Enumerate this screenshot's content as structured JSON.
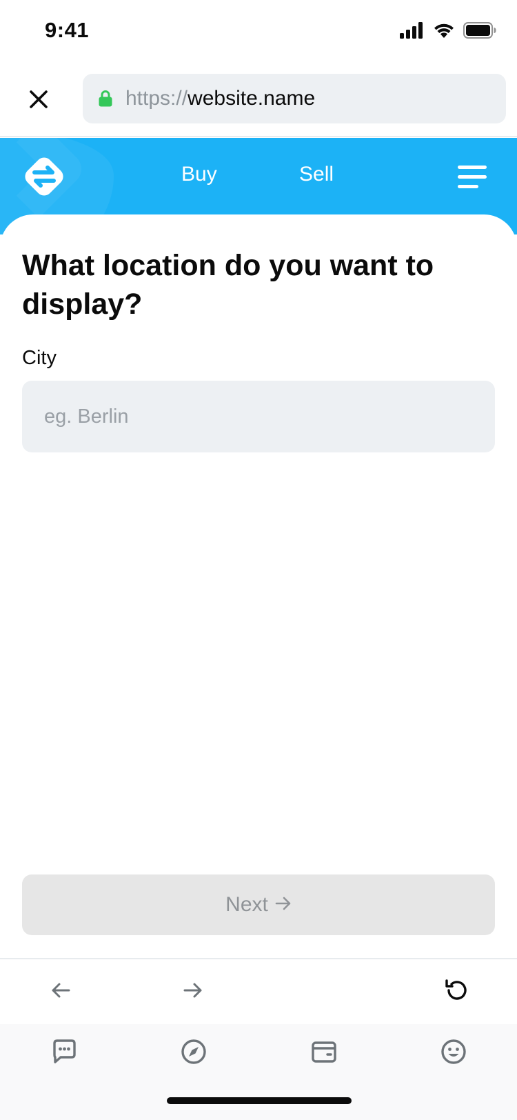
{
  "status_bar": {
    "time": "9:41",
    "icons": [
      "cellular-signal-icon",
      "wifi-icon",
      "battery-icon"
    ]
  },
  "browser": {
    "close_icon": "close-icon",
    "url_scheme": "https://",
    "url_host": "website.name",
    "lock_icon": "lock-icon",
    "lock_color": "#34c759"
  },
  "site_header": {
    "background_color": "#1cb2f6",
    "logo_icon": "exchange-arrows-logo-icon",
    "nav": [
      {
        "label": "Buy"
      },
      {
        "label": "Sell"
      }
    ],
    "menu_icon": "hamburger-menu-icon"
  },
  "form": {
    "title": "What location do you want to display?",
    "city_label": "City",
    "city_value": "",
    "city_placeholder": "eg. Berlin",
    "next_label": "Next",
    "next_icon": "arrow-right-icon",
    "next_enabled": false
  },
  "browser_nav": {
    "back_icon": "arrow-left-icon",
    "forward_icon": "arrow-right-icon",
    "reload_icon": "reload-icon"
  },
  "tab_bar": {
    "tabs": [
      {
        "icon": "chat-bubble-icon"
      },
      {
        "icon": "compass-icon"
      },
      {
        "icon": "wallet-icon"
      },
      {
        "icon": "smiley-face-icon"
      }
    ]
  }
}
